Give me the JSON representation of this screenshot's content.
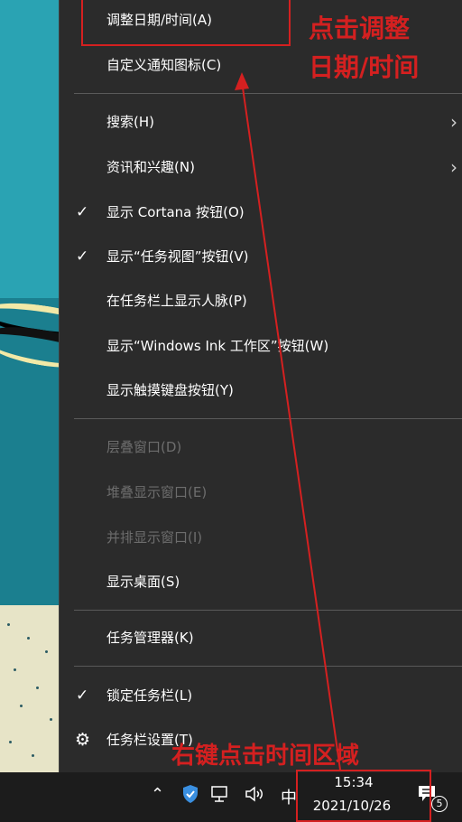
{
  "menu": {
    "items": [
      {
        "label": "调整日期/时间(A)",
        "checked": false,
        "disabled": false,
        "submenu": false
      },
      {
        "label": "自定义通知图标(C)",
        "checked": false,
        "disabled": false,
        "submenu": false
      },
      {
        "label": "搜索(H)",
        "checked": false,
        "disabled": false,
        "submenu": true
      },
      {
        "label": "资讯和兴趣(N)",
        "checked": false,
        "disabled": false,
        "submenu": true
      },
      {
        "label": "显示 Cortana 按钮(O)",
        "checked": true,
        "disabled": false,
        "submenu": false
      },
      {
        "label": "显示“任务视图”按钮(V)",
        "checked": true,
        "disabled": false,
        "submenu": false
      },
      {
        "label": "在任务栏上显示人脉(P)",
        "checked": false,
        "disabled": false,
        "submenu": false
      },
      {
        "label": "显示“Windows Ink 工作区”按钮(W)",
        "checked": false,
        "disabled": false,
        "submenu": false
      },
      {
        "label": "显示触摸键盘按钮(Y)",
        "checked": false,
        "disabled": false,
        "submenu": false
      },
      {
        "label": "层叠窗口(D)",
        "checked": false,
        "disabled": true,
        "submenu": false
      },
      {
        "label": "堆叠显示窗口(E)",
        "checked": false,
        "disabled": true,
        "submenu": false
      },
      {
        "label": "并排显示窗口(I)",
        "checked": false,
        "disabled": true,
        "submenu": false
      },
      {
        "label": "显示桌面(S)",
        "checked": false,
        "disabled": false,
        "submenu": false
      },
      {
        "label": "任务管理器(K)",
        "checked": false,
        "disabled": false,
        "submenu": false
      },
      {
        "label": "锁定任务栏(L)",
        "checked": true,
        "disabled": false,
        "submenu": false
      },
      {
        "label": "任务栏设置(T)",
        "checked": false,
        "disabled": false,
        "submenu": false,
        "icon": "gear-icon"
      }
    ],
    "check_glyph": "✓",
    "arrow_glyph": "›",
    "gear_glyph": "⚙"
  },
  "taskbar": {
    "time": "15:34",
    "date": "2021/10/26",
    "ime_label": "中",
    "notification_count": "5",
    "icons": [
      "chevron-up-icon",
      "shield-icon",
      "network-icon",
      "volume-icon",
      "notification-icon"
    ]
  },
  "annotations": {
    "top_text_line1": "点击调整",
    "top_text_line2": "日期/时间",
    "bottom_text": "右键点击时间区域",
    "color": "#d42020"
  },
  "colors": {
    "menu_bg": "#2b2b2b",
    "menu_text": "#ffffff",
    "menu_disabled": "#6d6d6d",
    "taskbar_bg": "#1c1c1c",
    "shield_blue": "#3a8fe0"
  }
}
